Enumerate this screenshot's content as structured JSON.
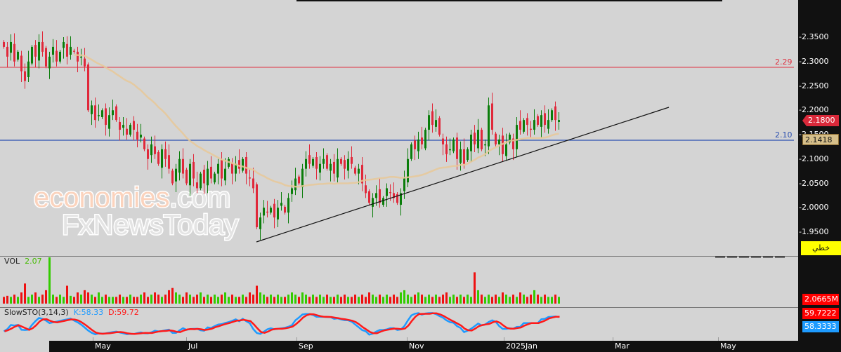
{
  "chart_data": {
    "type": "candlestick",
    "title": "",
    "yaxis": {
      "ticks": [
        "2.3500",
        "2.3000",
        "2.2500",
        "2.2000",
        "2.1500",
        "2.1000",
        "2.0500",
        "2.0000",
        "1.9500"
      ],
      "range": [
        1.9,
        2.4
      ]
    },
    "xaxis": {
      "ticks": [
        "May",
        "Jul",
        "Sep",
        "Nov",
        "2025Jan",
        "Mar",
        "May"
      ]
    },
    "closes": [
      2.33,
      2.31,
      2.34,
      2.3,
      2.32,
      2.28,
      2.26,
      2.3,
      2.33,
      2.31,
      2.34,
      2.32,
      2.29,
      2.31,
      2.33,
      2.3,
      2.32,
      2.34,
      2.31,
      2.33,
      2.32,
      2.3,
      2.31,
      2.29,
      2.2,
      2.21,
      2.18,
      2.19,
      2.2,
      2.17,
      2.19,
      2.2,
      2.18,
      2.16,
      2.17,
      2.15,
      2.17,
      2.16,
      2.14,
      2.15,
      2.12,
      2.1,
      2.13,
      2.11,
      2.09,
      2.12,
      2.1,
      2.08,
      2.05,
      2.08,
      2.1,
      2.07,
      2.05,
      2.09,
      2.06,
      2.04,
      2.07,
      2.05,
      2.08,
      2.06,
      2.07,
      2.09,
      2.06,
      2.08,
      2.1,
      2.07,
      2.09,
      2.08,
      2.1,
      2.07,
      2.06,
      2.04,
      1.96,
      1.98,
      2.0,
      1.99,
      2.0,
      1.98,
      2.0,
      2.01,
      1.99,
      2.02,
      2.04,
      2.06,
      2.05,
      2.08,
      2.1,
      2.09,
      2.1,
      2.08,
      2.09,
      2.1,
      2.08,
      2.09,
      2.07,
      2.1,
      2.09,
      2.08,
      2.1,
      2.09,
      2.07,
      2.08,
      2.05,
      2.03,
      2.01,
      2.02,
      2.03,
      2.01,
      2.02,
      2.04,
      2.03,
      2.02,
      2.01,
      2.03,
      2.06,
      2.1,
      2.13,
      2.12,
      2.14,
      2.13,
      2.16,
      2.19,
      2.17,
      2.18,
      2.15,
      2.13,
      2.11,
      2.12,
      2.14,
      2.1,
      2.12,
      2.09,
      2.12,
      2.15,
      2.13,
      2.16,
      2.12,
      2.13,
      2.21,
      2.16,
      2.13,
      2.14,
      2.11,
      2.13,
      2.15,
      2.12,
      2.17,
      2.16,
      2.18,
      2.17,
      2.16,
      2.18,
      2.17,
      2.19,
      2.17,
      2.18,
      2.2,
      2.18,
      2.18
    ],
    "volumes": [
      0.3,
      0.35,
      0.3,
      0.4,
      0.3,
      0.5,
      0.9,
      0.3,
      0.4,
      0.5,
      0.3,
      0.4,
      0.6,
      2.07,
      0.4,
      0.3,
      0.4,
      0.3,
      0.8,
      0.35,
      0.3,
      0.5,
      0.4,
      0.6,
      0.5,
      0.4,
      0.3,
      0.5,
      0.3,
      0.4,
      0.3,
      0.3,
      0.3,
      0.4,
      0.3,
      0.3,
      0.4,
      0.3,
      0.3,
      0.4,
      0.5,
      0.3,
      0.4,
      0.5,
      0.4,
      0.3,
      0.4,
      0.6,
      0.7,
      0.5,
      0.4,
      0.3,
      0.5,
      0.4,
      0.3,
      0.4,
      0.5,
      0.3,
      0.4,
      0.3,
      0.4,
      0.3,
      0.4,
      0.5,
      0.3,
      0.4,
      0.3,
      0.3,
      0.4,
      0.3,
      0.5,
      0.4,
      0.8,
      0.5,
      0.4,
      0.3,
      0.4,
      0.3,
      0.4,
      0.3,
      0.3,
      0.4,
      0.5,
      0.4,
      0.3,
      0.5,
      0.4,
      0.3,
      0.4,
      0.3,
      0.4,
      0.3,
      0.4,
      0.3,
      0.3,
      0.4,
      0.3,
      0.4,
      0.3,
      0.3,
      0.4,
      0.3,
      0.4,
      0.3,
      0.5,
      0.4,
      0.3,
      0.4,
      0.3,
      0.4,
      0.3,
      0.4,
      0.3,
      0.5,
      0.6,
      0.4,
      0.3,
      0.4,
      0.5,
      0.4,
      0.3,
      0.4,
      0.3,
      0.4,
      0.3,
      0.4,
      0.5,
      0.3,
      0.4,
      0.3,
      0.4,
      0.3,
      0.4,
      0.3,
      1.4,
      0.6,
      0.4,
      0.3,
      0.4,
      0.3,
      0.4,
      0.3,
      0.5,
      0.4,
      0.3,
      0.4,
      0.3,
      0.5,
      0.4,
      0.3,
      0.4,
      0.6,
      0.4,
      0.3,
      0.4,
      0.3,
      0.3,
      0.4,
      0.3
    ],
    "last_price": "2.1800",
    "ma_value": "2.1418",
    "hlines": [
      {
        "label": "2.29",
        "color": "#e03040"
      },
      {
        "label": "2.10",
        "color": "#2a4fb0"
      }
    ],
    "colors": {
      "up": "#0a7d0a",
      "down": "#e0283a",
      "ma": "#e8c898",
      "vol_up": "#33cc00",
      "vol_down": "#ee1111",
      "k": "#1e9bff",
      "d": "#ff1a1a"
    }
  },
  "mode_label": "خطي",
  "volume_panel": {
    "label": "VOL",
    "value": "2.07",
    "axis_value": "2.0665M"
  },
  "stoch_panel": {
    "label": "SlowSTO(3,14,3)",
    "k_label": "K:58.33",
    "d_label": "D:59.72",
    "d_axis": "59.7222",
    "k_axis": "58.3333"
  },
  "watermark": {
    "line1a": "economies",
    "line1b": ".com",
    "line2": "FxNewsToday"
  }
}
